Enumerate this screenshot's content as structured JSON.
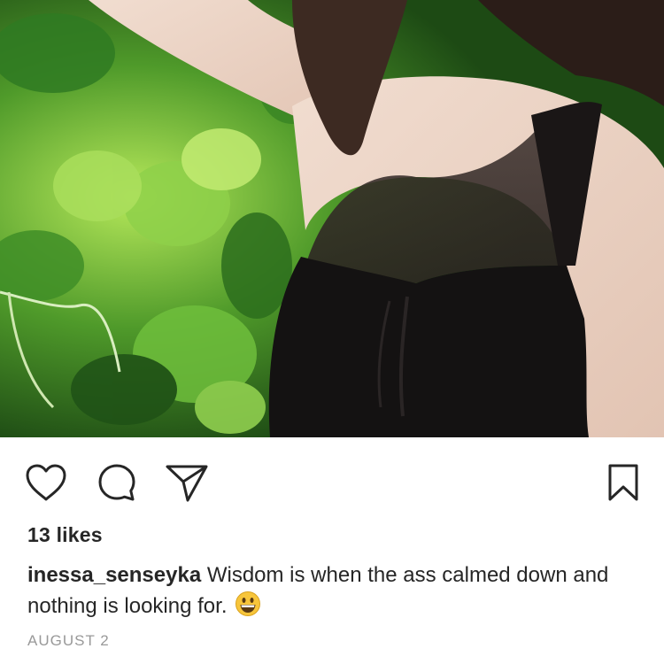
{
  "post": {
    "image_alt": "Woman in black tank top with mesh neckline against green leaves",
    "likes_text": "13 likes",
    "caption": {
      "username": "inessa_senseyka",
      "text": "Wisdom is when the ass calmed down and nothing is looking for.",
      "emoji": "grinning-face-emoji"
    },
    "date": "AUGUST 2"
  },
  "actions": {
    "like_icon": "heart-icon",
    "comment_icon": "comment-icon",
    "share_icon": "send-icon",
    "save_icon": "bookmark-icon"
  },
  "colors": {
    "text": "#262626",
    "muted": "#999999",
    "icon": "#262626",
    "background": "#ffffff"
  }
}
